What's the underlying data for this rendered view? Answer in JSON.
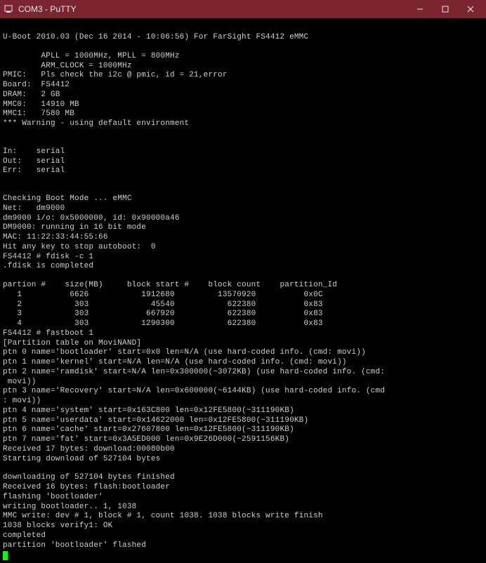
{
  "window": {
    "title": "COM3 - PuTTY"
  },
  "terminal": {
    "lines": [
      "",
      "U-Boot 2010.03 (Dec 16 2014 - 10:06:56) For FarSight FS4412 eMMC",
      "",
      "        APLL = 1000MHz, MPLL = 800MHz",
      "        ARM_CLOCK = 1000MHz",
      "PMIC:   Pls check the i2c @ pmic, id = 21,error",
      "Board:  FS4412",
      "DRAM:   2 GB",
      "MMC0:   14910 MB",
      "MMC1:   7580 MB",
      "*** Warning - using default environment",
      "",
      "",
      "In:    serial",
      "Out:   serial",
      "Err:   serial",
      "",
      "",
      "Checking Boot Mode ... eMMC",
      "Net:   dm9000",
      "dm9000 i/o: 0x5000000, id: 0x90000a46",
      "DM9000: running in 16 bit mode",
      "MAC: 11:22:33:44:55:66",
      "Hit any key to stop autoboot:  0",
      "FS4412 # fdisk -c 1",
      ".fdisk is completed",
      "",
      "partion #    size(MB)     block start #    block count    partition_Id",
      "   1          6626           1912680         13570920          0x0C",
      "   2           303             45540           622380          0x83",
      "   3           303            667920           622380          0x83",
      "   4           303           1290300           622380          0x83",
      "FS4412 # fastboot 1",
      "[Partition table on MoviNAND]",
      "ptn 0 name='bootloader' start=0x0 len=N/A (use hard-coded info. (cmd: movi))",
      "ptn 1 name='kernel' start=N/A len=N/A (use hard-coded info. (cmd: movi))",
      "ptn 2 name='ramdisk' start=N/A len=0x300000(~3072KB) (use hard-coded info. (cmd:",
      " movi))",
      "ptn 3 name='Recovery' start=N/A len=0x600000(~6144KB) (use hard-coded info. (cmd",
      ": movi))",
      "ptn 4 name='system' start=0x163C800 len=0x12FE5800(~311190KB)",
      "ptn 5 name='userdata' start=0x14622000 len=0x12FE5800(~311190KB)",
      "ptn 6 name='cache' start=0x27607800 len=0x12FE5800(~311190KB)",
      "ptn 7 name='fat' start=0x3A5ED000 len=0x9E26D000(~2591156KB)",
      "Received 17 bytes: download:00080b00",
      "Starting download of 527104 bytes",
      "",
      "downloading of 527104 bytes finished",
      "Received 16 bytes: flash:bootloader",
      "flashing 'bootloader'",
      "writing bootloader.. 1, 1038",
      "MMC write: dev # 1, block # 1, count 1038. 1038 blocks write finish",
      "1038 blocks verify1: OK",
      "completed",
      "partition 'bootloader' flashed"
    ]
  }
}
